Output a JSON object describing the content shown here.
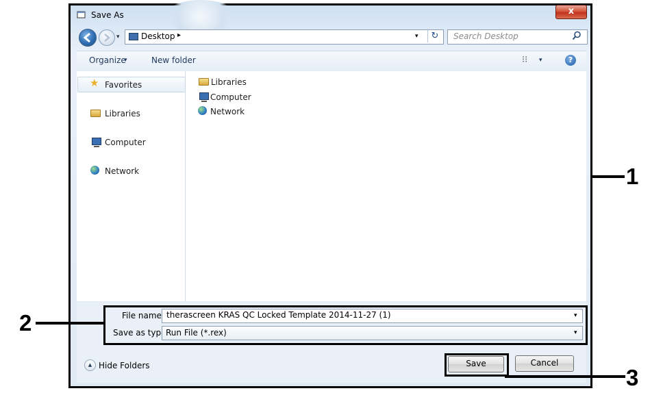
{
  "window": {
    "title": "Save As",
    "close_glyph": "x"
  },
  "nav": {
    "address": "Desktop",
    "address_separator": "▸",
    "search_placeholder": "Search Desktop",
    "refresh_glyph": "↻"
  },
  "toolbar": {
    "organize_label": "Organize",
    "new_folder_label": "New folder",
    "dropdown_glyph": "▾",
    "views_glyph": "⁝⁝",
    "help_glyph": "?"
  },
  "sidebar": {
    "items": [
      {
        "label": "Favorites",
        "icon": "star-icon"
      },
      {
        "label": "Libraries",
        "icon": "libraries-icon"
      },
      {
        "label": "Computer",
        "icon": "computer-icon"
      },
      {
        "label": "Network",
        "icon": "network-icon"
      }
    ]
  },
  "files": {
    "items": [
      {
        "label": "Libraries",
        "icon": "libraries-icon"
      },
      {
        "label": "Computer",
        "icon": "computer-icon"
      },
      {
        "label": "Network",
        "icon": "network-icon"
      }
    ]
  },
  "form": {
    "file_name_label": "File name:",
    "file_name_value": "therascreen KRAS QC Locked Template 2014-11-27 (1)",
    "save_type_label": "Save as type:",
    "save_type_value": "Run File (*.rex)"
  },
  "footer": {
    "hide_folders_label": "Hide Folders",
    "hide_glyph": "▲",
    "save_label": "Save",
    "cancel_label": "Cancel"
  },
  "callouts": [
    "1",
    "2",
    "3"
  ],
  "colors": {
    "frame": "#000000",
    "close_button": "#c9452b",
    "toolbar_text": "#1e395b",
    "panel_bg": "#e9f0f7"
  }
}
